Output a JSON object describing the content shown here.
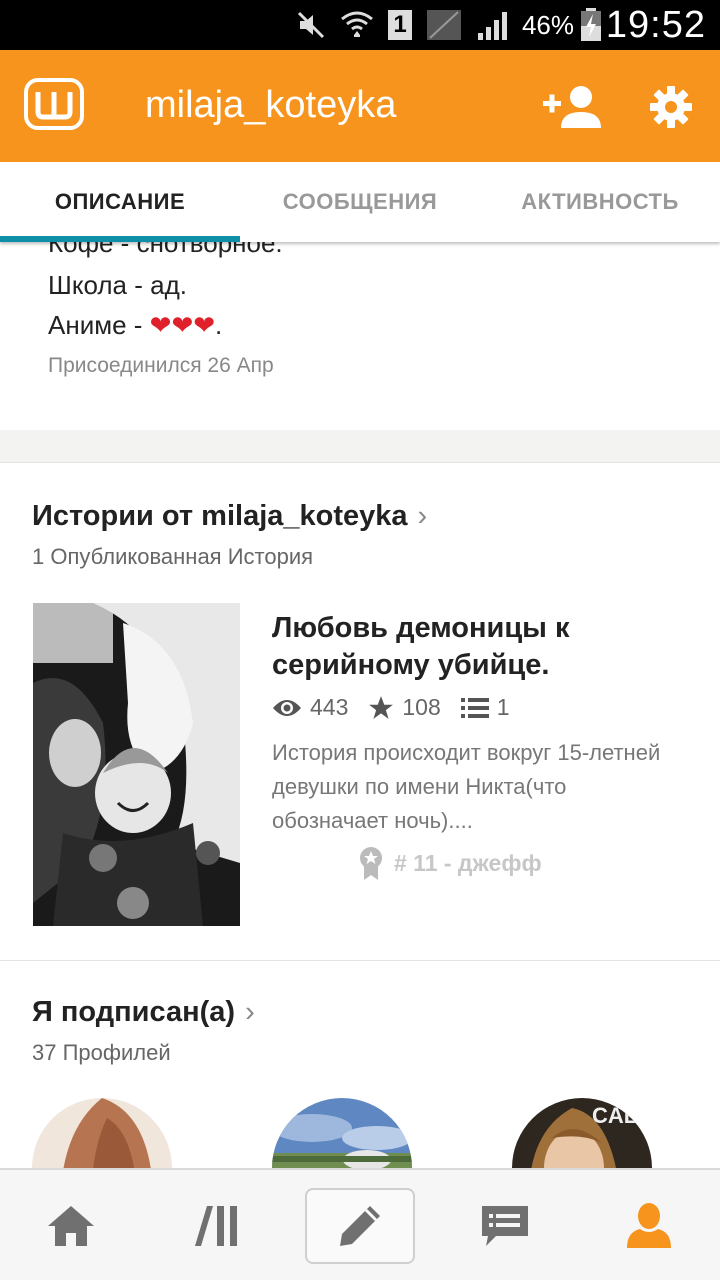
{
  "status_bar": {
    "battery_percent": "46%",
    "time": "19:52",
    "sim_slot": "1",
    "icons": [
      "mute-icon",
      "wifi-icon",
      "sim-icon",
      "signal-icon",
      "battery-charging-icon"
    ]
  },
  "header": {
    "app_logo": "Ш",
    "title": "milaja_koteyka",
    "add_user_icon": "add-user-icon",
    "settings_icon": "gear-icon",
    "color": "#f7941d"
  },
  "tabs": [
    {
      "label": "ОПИСАНИЕ",
      "active": true
    },
    {
      "label": "СООБЩЕНИЯ",
      "active": false
    },
    {
      "label": "АКТИВНОСТЬ",
      "active": false
    }
  ],
  "about": {
    "lines": [
      "Кофе - снотворное.",
      "Школа - ад.",
      "Аниме - "
    ],
    "hearts": "❤❤❤",
    "period": ".",
    "joined": "Присоединился 26 Апр"
  },
  "stories": {
    "title": "Истории от milaja_koteyka",
    "subtitle": "1 Опубликованная История",
    "items": [
      {
        "title": "Любовь демоницы к серийному убийце.",
        "reads": "443",
        "votes": "108",
        "parts": "1",
        "description": "История происходит вокруг 15-летней девушки по имени Никта(что обозначает ночь)....",
        "rank": "# 11 - джефф"
      }
    ]
  },
  "following": {
    "title": "Я подписан(а)",
    "subtitle": "37 Профилей",
    "avatar_overlay_text": "CAL"
  },
  "bottom_nav": [
    {
      "name": "home-icon"
    },
    {
      "name": "library-icon"
    },
    {
      "name": "write-icon"
    },
    {
      "name": "messages-icon"
    },
    {
      "name": "profile-icon",
      "active": true
    }
  ]
}
